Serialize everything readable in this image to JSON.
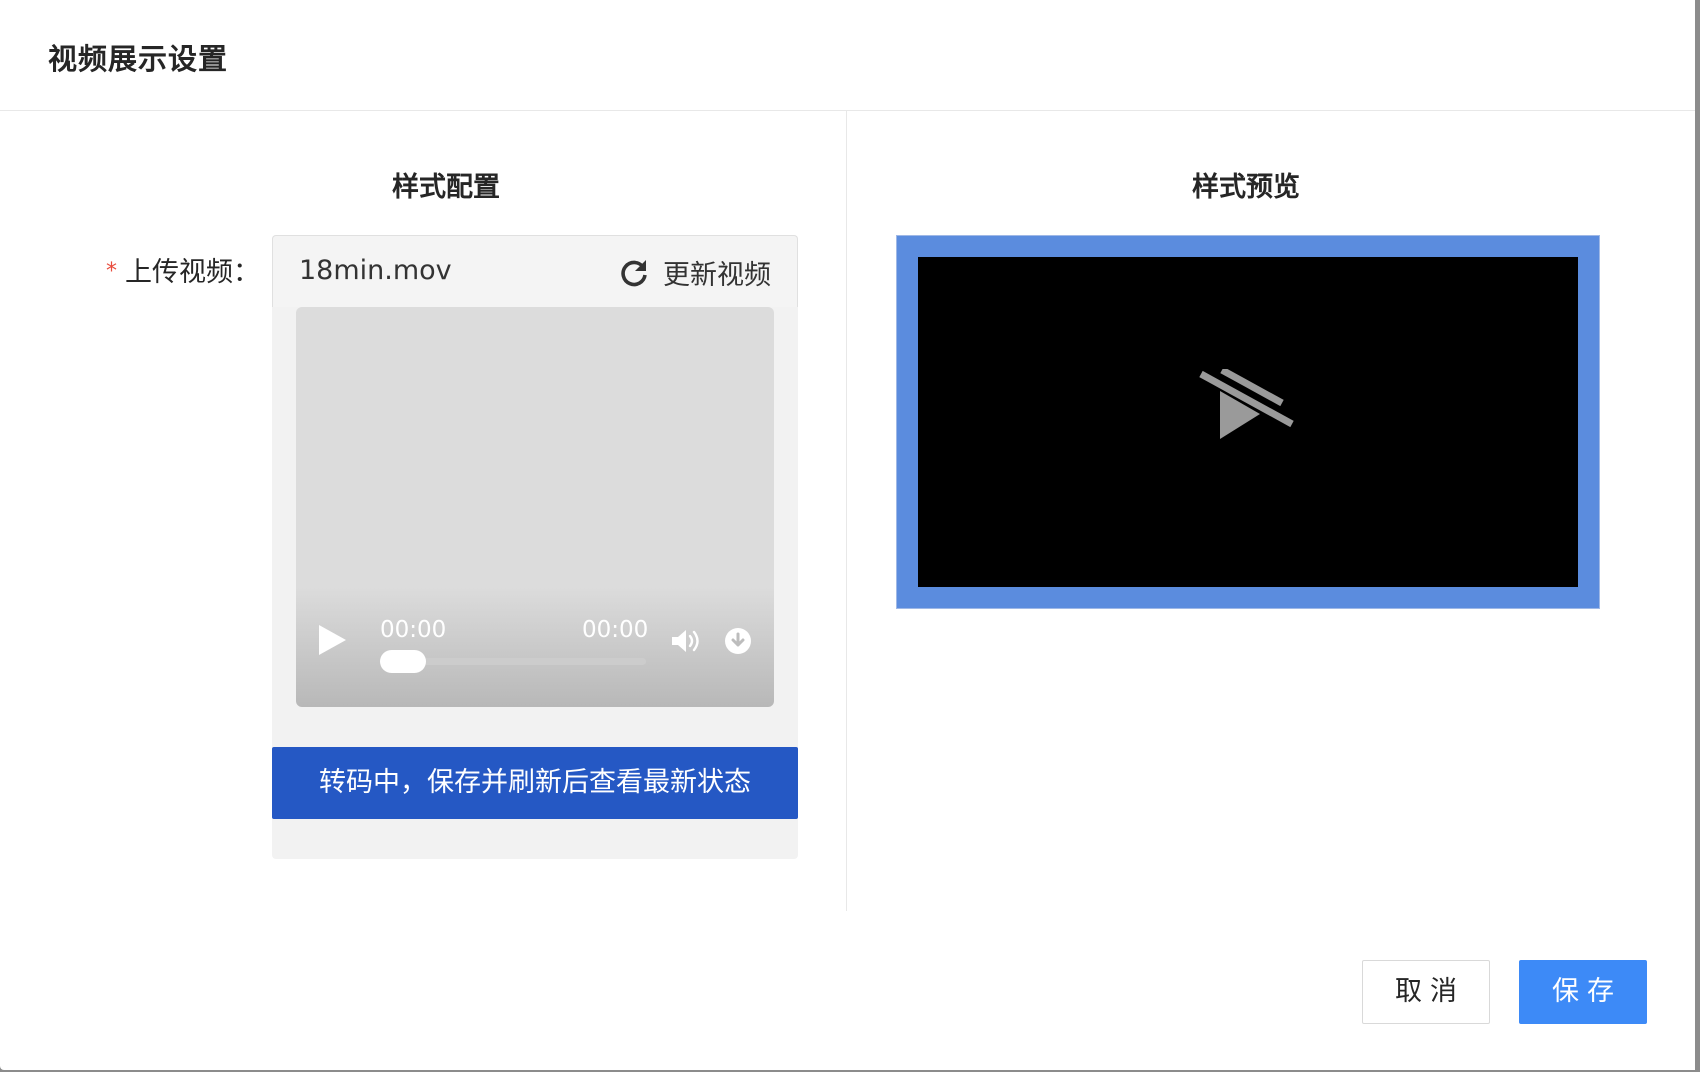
{
  "dialog": {
    "title": "视频展示设置"
  },
  "config": {
    "section_title": "样式配置",
    "upload_label": "上传视频：",
    "required_mark": "*",
    "file_name": "18min.mov",
    "refresh_label": "更新视频",
    "player": {
      "current_time": "00:00",
      "duration": "00:00",
      "progress": 0
    },
    "status_text": "转码中，保存并刷新后查看最新状态"
  },
  "preview": {
    "section_title": "样式预览"
  },
  "footer": {
    "cancel_label": "取消",
    "save_label": "保存"
  },
  "colors": {
    "primary": "#3d8af7",
    "status_bar": "#2558c4",
    "preview_border": "#5b8cde",
    "required": "#e84c3d"
  }
}
